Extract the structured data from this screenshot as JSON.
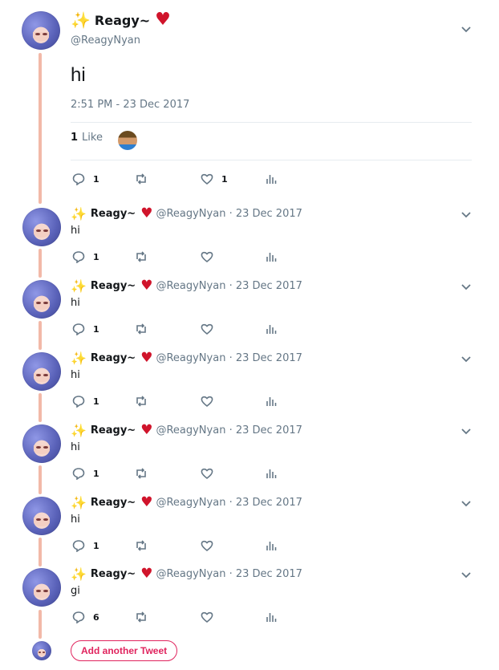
{
  "main_tweet": {
    "display_name": "Reagy~",
    "handle": "@ReagyNyan",
    "text": "hi",
    "timestamp": "2:51 PM - 23 Dec 2017",
    "likes_count": "1",
    "likes_label": "Like",
    "reply_count": "1",
    "like_count": "1"
  },
  "replies": [
    {
      "display_name": "Reagy~",
      "meta": "@ReagyNyan · 23 Dec 2017",
      "text": "hi",
      "reply_count": "1"
    },
    {
      "display_name": "Reagy~",
      "meta": "@ReagyNyan · 23 Dec 2017",
      "text": "hi",
      "reply_count": "1"
    },
    {
      "display_name": "Reagy~",
      "meta": "@ReagyNyan · 23 Dec 2017",
      "text": "hi",
      "reply_count": "1"
    },
    {
      "display_name": "Reagy~",
      "meta": "@ReagyNyan · 23 Dec 2017",
      "text": "hi",
      "reply_count": "1"
    },
    {
      "display_name": "Reagy~",
      "meta": "@ReagyNyan · 23 Dec 2017",
      "text": "hi",
      "reply_count": "1"
    },
    {
      "display_name": "Reagy~",
      "meta": "@ReagyNyan · 23 Dec 2017",
      "text": "gi",
      "reply_count": "6"
    }
  ],
  "compose": {
    "button_label": "Add another Tweet"
  },
  "icons": {
    "sparkle": "sparkles-emoji-icon",
    "heart_emoji": "red-heart-emoji-icon",
    "reply": "reply-icon",
    "retweet": "retweet-icon",
    "like": "heart-icon",
    "analytics": "analytics-icon",
    "chevron": "chevron-down-icon"
  },
  "colors": {
    "thread_line": "#f2b9a8",
    "accent": "#e0245e",
    "secondary_text": "#657786"
  }
}
